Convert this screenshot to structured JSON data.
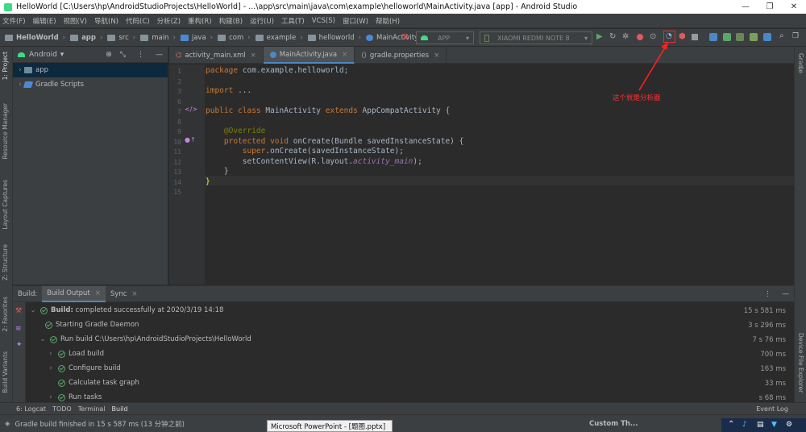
{
  "window": {
    "title": "HelloWorld [C:\\Users\\hp\\AndroidStudioProjects\\HelloWorld] - ...\\app\\src\\main\\java\\com\\example\\helloworld\\MainActivity.java [app] - Android Studio"
  },
  "menu": [
    "文件(F)",
    "编辑(E)",
    "视图(V)",
    "导航(N)",
    "代码(C)",
    "分析(Z)",
    "重构(R)",
    "构建(B)",
    "运行(U)",
    "工具(T)",
    "VCS(S)",
    "窗口(W)",
    "帮助(H)"
  ],
  "breadcrumbs": [
    "HelloWorld",
    "app",
    "src",
    "main",
    "java",
    "com",
    "example",
    "helloworld",
    "MainActivity"
  ],
  "toolbar": {
    "run_config": "APP",
    "device": "XIAOMI REDMI NOTE 8"
  },
  "left_tool_tabs": [
    "1: Project",
    "Resource Manager",
    "Layout Captures",
    "Z: Structure",
    "2: Favorites",
    "Build Variants"
  ],
  "right_tool_tabs": [
    "Gradle",
    "Device File Explorer"
  ],
  "project": {
    "view": "Android",
    "items": [
      "app",
      "Gradle Scripts"
    ]
  },
  "editor_tabs": [
    {
      "label": "activity_main.xml"
    },
    {
      "label": "MainActivity.java"
    },
    {
      "label": "gradle.properties"
    }
  ],
  "code": {
    "line_numbers": [
      "1",
      "2",
      "3",
      "6",
      "7",
      "8",
      "9",
      "10",
      "11",
      "12",
      "13",
      "14",
      "15"
    ],
    "pkg_kw": "package",
    "pkg_name": "com.example.helloworld;",
    "import_kw": "import",
    "import_rest": "...",
    "cls_kw1": "public class",
    "cls_name": "MainActivity",
    "cls_kw2": "extends",
    "cls_super": "AppCompatActivity {",
    "override": "@Override",
    "m_kw": "protected void",
    "m_rest": "onCreate(Bundle savedInstanceState) {",
    "super_kw": "super",
    "super_rest": ".onCreate(savedInstanceState);",
    "scv_a": "setContentView(R.layout.",
    "scv_b": "activity_main",
    "scv_c": ");",
    "close1": "}",
    "close2": "}"
  },
  "annotation": "这个就是分析器",
  "build": {
    "label": "Build:",
    "tabs": [
      "Build Output",
      "Sync"
    ],
    "rows": [
      {
        "text_bold": "Build:",
        "text": "completed successfully at 2020/3/19 14:18",
        "time": "15 s 581 ms"
      },
      {
        "text": "Starting Gradle Daemon",
        "time": "3 s 296 ms"
      },
      {
        "text": "Run build C:\\Users\\hp\\AndroidStudioProjects\\HelloWorld",
        "time": "7 s 76 ms"
      },
      {
        "text": "Load build",
        "time": "700 ms"
      },
      {
        "text": "Configure build",
        "time": "163 ms"
      },
      {
        "text": "Calculate task graph",
        "time": "33 ms"
      },
      {
        "text": "Run tasks",
        "time": "s 68 ms"
      }
    ]
  },
  "bottom_tabs": [
    "6: Logcat",
    "TODO",
    "Terminal",
    "Build",
    "Event Log"
  ],
  "status": {
    "text": "Gradle build finished in 15 s 587 ms (13 分钟之前)",
    "right": "Custom Th..."
  },
  "taskbar_popup": "Microsoft PowerPoint - [题图.pptx]"
}
